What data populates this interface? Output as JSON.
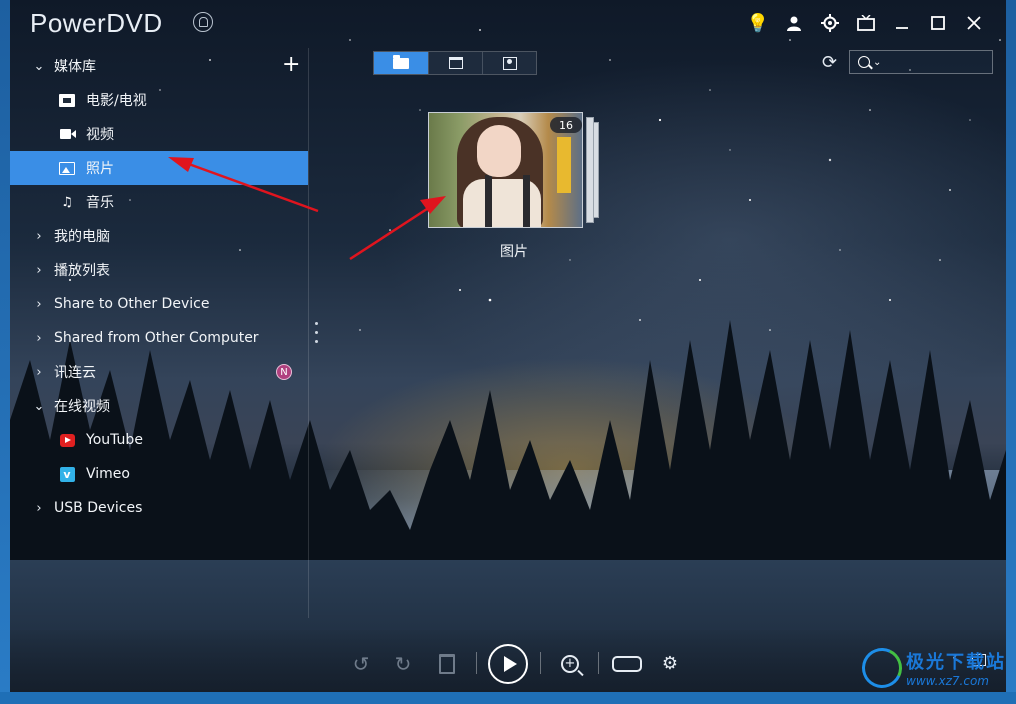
{
  "app": {
    "title": "PowerDVD"
  },
  "titlebar": {
    "buttons": [
      "bulb-icon",
      "user-icon",
      "settings-icon",
      "tv-icon",
      "minimize-icon",
      "maximize-icon",
      "close-icon"
    ]
  },
  "sidebar": {
    "items": [
      {
        "label": "媒体库",
        "expanded": true
      },
      {
        "label": "电影/电视",
        "icon": "film-icon"
      },
      {
        "label": "视频",
        "icon": "video-icon"
      },
      {
        "label": "照片",
        "icon": "photo-icon",
        "selected": true
      },
      {
        "label": "音乐",
        "icon": "music-icon"
      },
      {
        "label": "我的电脑",
        "expanded": false
      },
      {
        "label": "播放列表",
        "expanded": false
      },
      {
        "label": "Share to Other Device",
        "expanded": false
      },
      {
        "label": "Shared from Other Computer",
        "expanded": false
      },
      {
        "label": "讯连云",
        "expanded": false,
        "badge": "N"
      },
      {
        "label": "在线视频",
        "expanded": true
      },
      {
        "label": "YouTube",
        "icon": "youtube-icon"
      },
      {
        "label": "Vimeo",
        "icon": "vimeo-icon"
      },
      {
        "label": "USB Devices",
        "expanded": false
      }
    ]
  },
  "views": {
    "tabs": [
      "folder-icon",
      "calendar-icon",
      "person-icon"
    ],
    "active": "folder-icon"
  },
  "search": {
    "value": ""
  },
  "album": {
    "name": "图片",
    "count": "16"
  },
  "watermark": {
    "title": "极光下载站",
    "url": "www.xz7.com"
  },
  "colors": {
    "accent": "#3a8ee6",
    "badge": "#b0417f",
    "arrow": "#e0141e"
  }
}
